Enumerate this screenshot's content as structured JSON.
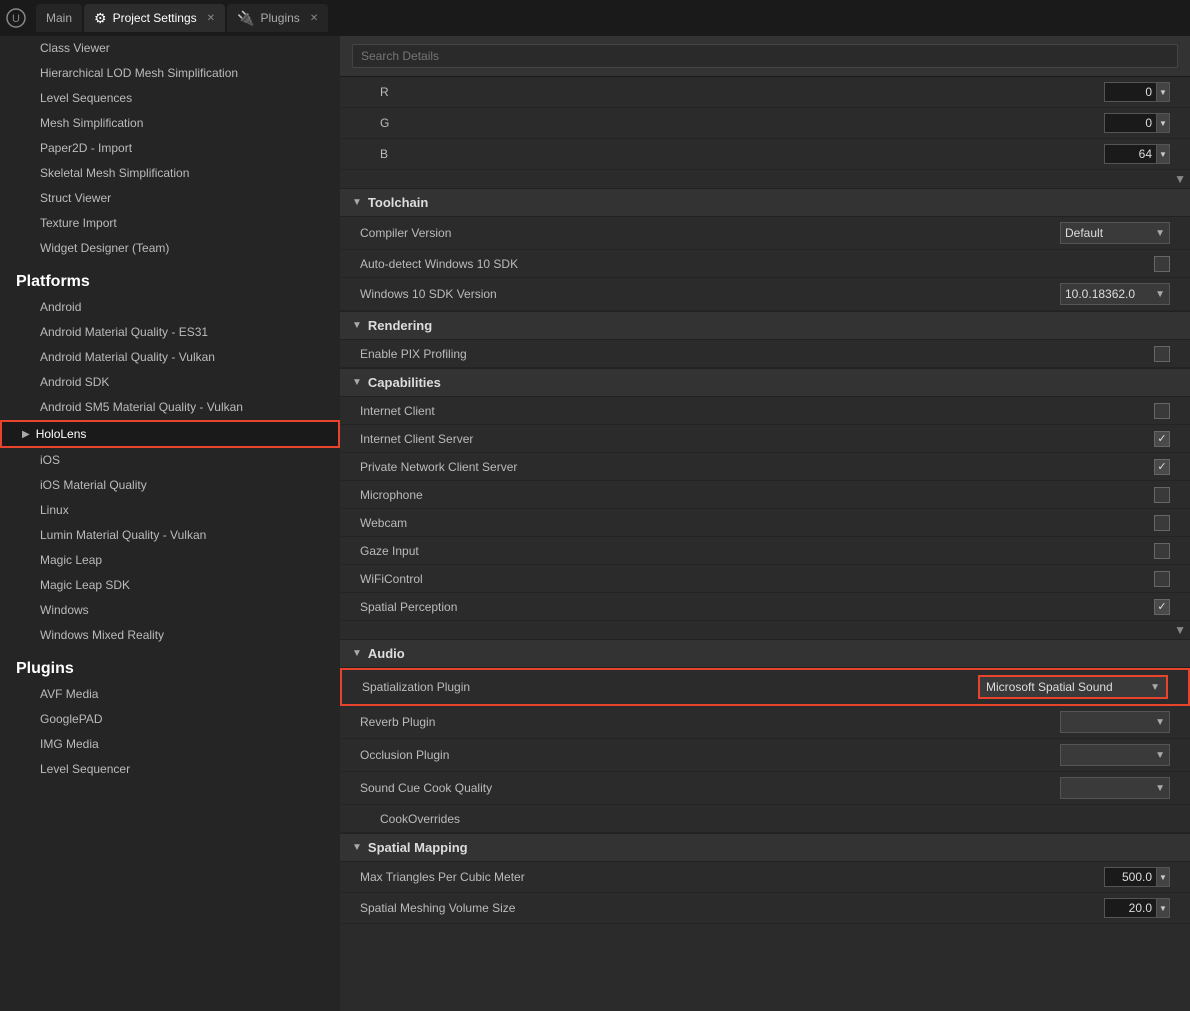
{
  "tabs": [
    {
      "label": "Main",
      "active": false,
      "closable": false,
      "icon": ""
    },
    {
      "label": "Project Settings",
      "active": true,
      "closable": true,
      "icon": "⚙"
    },
    {
      "label": "Plugins",
      "active": false,
      "closable": true,
      "icon": "🔌"
    }
  ],
  "sidebar": {
    "sections": [
      {
        "type": "section",
        "label": ""
      }
    ],
    "items_top": [
      {
        "label": "Class Viewer"
      },
      {
        "label": "Hierarchical LOD Mesh Simplification"
      },
      {
        "label": "Level Sequences"
      },
      {
        "label": "Mesh Simplification"
      },
      {
        "label": "Paper2D - Import"
      },
      {
        "label": "Skeletal Mesh Simplification"
      },
      {
        "label": "Struct Viewer"
      },
      {
        "label": "Texture Import"
      },
      {
        "label": "Widget Designer (Team)"
      }
    ],
    "platforms_header": "Platforms",
    "platform_items": [
      {
        "label": "Android",
        "selected": false
      },
      {
        "label": "Android Material Quality - ES31",
        "selected": false
      },
      {
        "label": "Android Material Quality - Vulkan",
        "selected": false
      },
      {
        "label": "Android SDK",
        "selected": false
      },
      {
        "label": "Android SM5 Material Quality - Vulkan",
        "selected": false
      },
      {
        "label": "HoloLens",
        "selected": true,
        "arrow": true
      },
      {
        "label": "iOS",
        "selected": false
      },
      {
        "label": "iOS Material Quality",
        "selected": false
      },
      {
        "label": "Linux",
        "selected": false
      },
      {
        "label": "Lumin Material Quality - Vulkan",
        "selected": false
      },
      {
        "label": "Magic Leap",
        "selected": false
      },
      {
        "label": "Magic Leap SDK",
        "selected": false
      },
      {
        "label": "Windows",
        "selected": false
      },
      {
        "label": "Windows Mixed Reality",
        "selected": false
      }
    ],
    "plugins_header": "Plugins",
    "plugin_items": [
      {
        "label": "AVF Media"
      },
      {
        "label": "GooglePAD"
      },
      {
        "label": "IMG Media"
      },
      {
        "label": "Level Sequencer"
      }
    ]
  },
  "search": {
    "placeholder": "Search Details"
  },
  "sections": {
    "color": {
      "fields": [
        {
          "label": "R",
          "value": "0"
        },
        {
          "label": "G",
          "value": "0"
        },
        {
          "label": "B",
          "value": "64"
        }
      ]
    },
    "toolchain": {
      "label": "Toolchain",
      "compiler_version_label": "Compiler Version",
      "compiler_version_value": "Default",
      "auto_detect_label": "Auto-detect Windows 10 SDK",
      "auto_detect_checked": false,
      "sdk_version_label": "Windows 10 SDK Version",
      "sdk_version_value": "10.0.18362.0"
    },
    "rendering": {
      "label": "Rendering",
      "pix_label": "Enable PIX Profiling",
      "pix_checked": false
    },
    "capabilities": {
      "label": "Capabilities",
      "items": [
        {
          "label": "Internet Client",
          "checked": false
        },
        {
          "label": "Internet Client Server",
          "checked": true
        },
        {
          "label": "Private Network Client Server",
          "checked": true
        },
        {
          "label": "Microphone",
          "checked": false
        },
        {
          "label": "Webcam",
          "checked": false
        },
        {
          "label": "Gaze Input",
          "checked": false
        },
        {
          "label": "WiFiControl",
          "checked": false
        },
        {
          "label": "Spatial Perception",
          "checked": true
        }
      ]
    },
    "audio": {
      "label": "Audio",
      "spatialization_label": "Spatialization Plugin",
      "spatialization_value": "Microsoft Spatial Sound",
      "reverb_label": "Reverb Plugin",
      "reverb_value": "",
      "occlusion_label": "Occlusion Plugin",
      "occlusion_value": "",
      "sound_cue_label": "Sound Cue Cook Quality",
      "sound_cue_value": "",
      "cook_overrides_label": "CookOverrides"
    },
    "spatial_mapping": {
      "label": "Spatial Mapping",
      "max_triangles_label": "Max Triangles Per Cubic Meter",
      "max_triangles_value": "500.0",
      "meshing_volume_label": "Spatial Meshing Volume Size",
      "meshing_volume_value": "20.0"
    }
  }
}
